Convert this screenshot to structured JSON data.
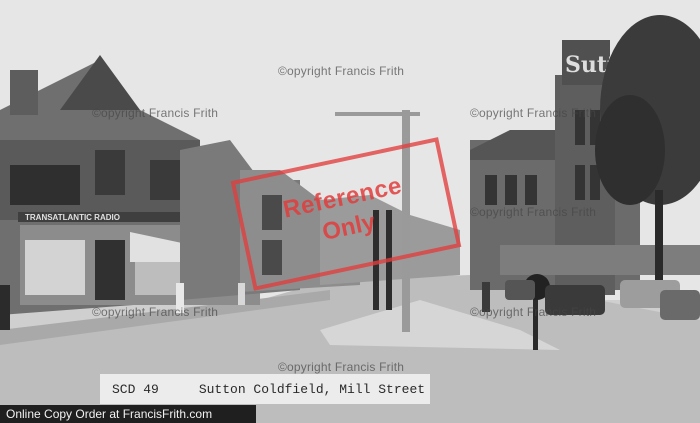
{
  "photo": {
    "watermark_text": "©opyright Francis Frith",
    "stamp": {
      "line1": "Reference",
      "line2": "Only"
    },
    "shop_sign": "TRANSATLANTIC RADIO",
    "building_sign": "Sutton"
  },
  "caption": {
    "code": "SCD 49",
    "title": "Sutton Coldfield, Mill Street"
  },
  "footer": {
    "text": "Online Copy Order at FrancisFrith.com"
  },
  "colors": {
    "sky": "#e6e6e6",
    "stamp": "#e23c3c"
  }
}
